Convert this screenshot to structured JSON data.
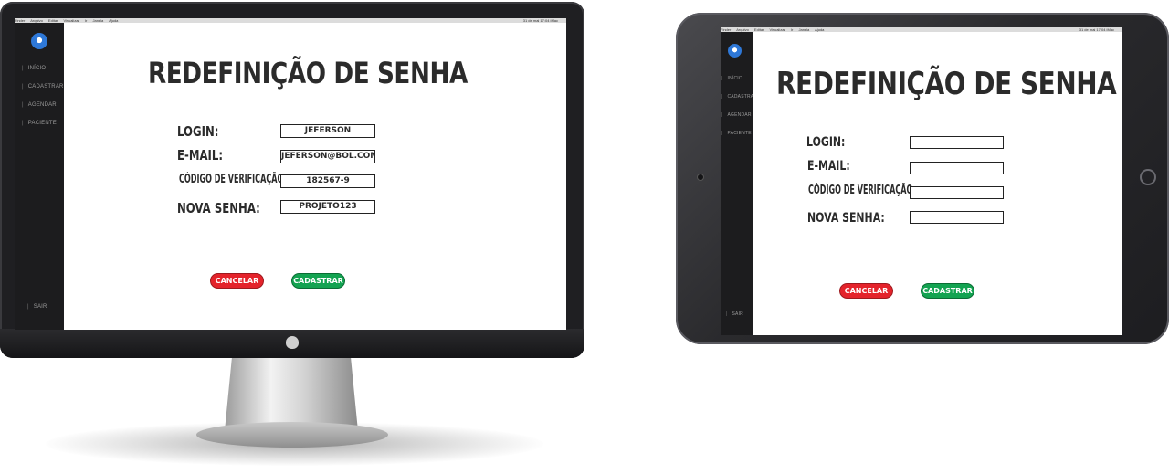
{
  "menubar": {
    "items": [
      "Finder",
      "Arquivo",
      "Editar",
      "Visualizar",
      "Ir",
      "Janela",
      "Ajuda"
    ],
    "right": "31 de mai 17:04  iMac"
  },
  "sidebar": {
    "items": [
      "INÍCIO",
      "CADASTRAR",
      "AGENDAR",
      "PACIENTE"
    ],
    "logout": "SAIR"
  },
  "form": {
    "title": "REDEFINIÇÃO DE SENHA",
    "labels": {
      "login": "LOGIN:",
      "email": "E-MAIL:",
      "code": "CÓDIGO DE VERIFICAÇÃO :",
      "password": "NOVA SENHA:"
    },
    "desktop_values": {
      "login": "JEFERSON",
      "email": "JEFERSON@BOL.COM",
      "code": "182567-9",
      "password": "PROJETO123"
    },
    "tablet_values": {
      "login": "",
      "email": "",
      "code": "",
      "password": ""
    },
    "cancel_label": "CANCELAR",
    "submit_label": "CADASTRAR"
  },
  "colors": {
    "cancel": "#e4232b",
    "submit": "#13a351",
    "sidebar": "#1c1c1e",
    "logo": "#2e78d8"
  },
  "icons": {
    "logo": "tooth-icon",
    "apple": "apple-logo-icon"
  }
}
